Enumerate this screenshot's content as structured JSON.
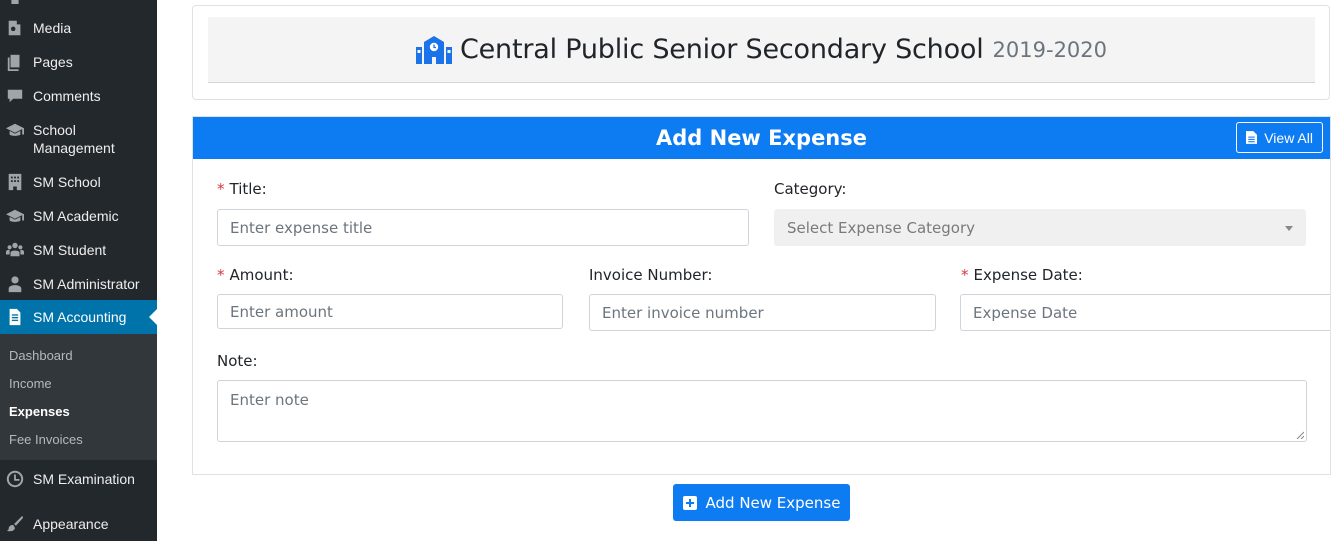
{
  "sidebar": {
    "items": [
      {
        "label": "Media",
        "icon": "media-icon"
      },
      {
        "label": "Pages",
        "icon": "pages-icon"
      },
      {
        "label": "Comments",
        "icon": "comments-icon"
      },
      {
        "label": "School Management",
        "label_line1": "School",
        "label_line2": "Management",
        "icon": "graduation-cap-icon"
      },
      {
        "label": "SM School",
        "icon": "building-icon"
      },
      {
        "label": "SM Academic",
        "icon": "graduation-cap-icon"
      },
      {
        "label": "SM Student",
        "icon": "users-icon"
      },
      {
        "label": "SM Administrator",
        "icon": "user-icon"
      },
      {
        "label": "SM Accounting",
        "icon": "document-icon",
        "current": true
      },
      {
        "label": "SM Examination",
        "icon": "clock-icon"
      },
      {
        "label": "Appearance",
        "icon": "paintbrush-icon"
      }
    ],
    "submenu": [
      {
        "label": "Dashboard"
      },
      {
        "label": "Income"
      },
      {
        "label": "Expenses",
        "active": true
      },
      {
        "label": "Fee Invoices"
      }
    ]
  },
  "header": {
    "school_name": "Central Public Senior Secondary School",
    "session": "2019-2020",
    "icon": "school-icon"
  },
  "form": {
    "title": "Add New Expense",
    "view_all_label": "View All",
    "fields": {
      "title": {
        "label": "Title:",
        "required_mark": "*",
        "placeholder": "Enter expense title"
      },
      "category": {
        "label": "Category:",
        "placeholder": "Select Expense Category"
      },
      "amount": {
        "label": "Amount:",
        "required_mark": "*",
        "placeholder": "Enter amount"
      },
      "invoice_number": {
        "label": "Invoice Number:",
        "placeholder": "Enter invoice number"
      },
      "expense_date": {
        "label": "Expense Date:",
        "required_mark": "*",
        "placeholder": "Expense Date"
      },
      "note": {
        "label": "Note:",
        "placeholder": "Enter note"
      }
    },
    "submit_label": "Add New Expense"
  },
  "colors": {
    "sidebar_bg": "#23282d",
    "sidebar_current": "#0073aa",
    "primary": "#0d7cf2",
    "required": "#dc3545"
  }
}
